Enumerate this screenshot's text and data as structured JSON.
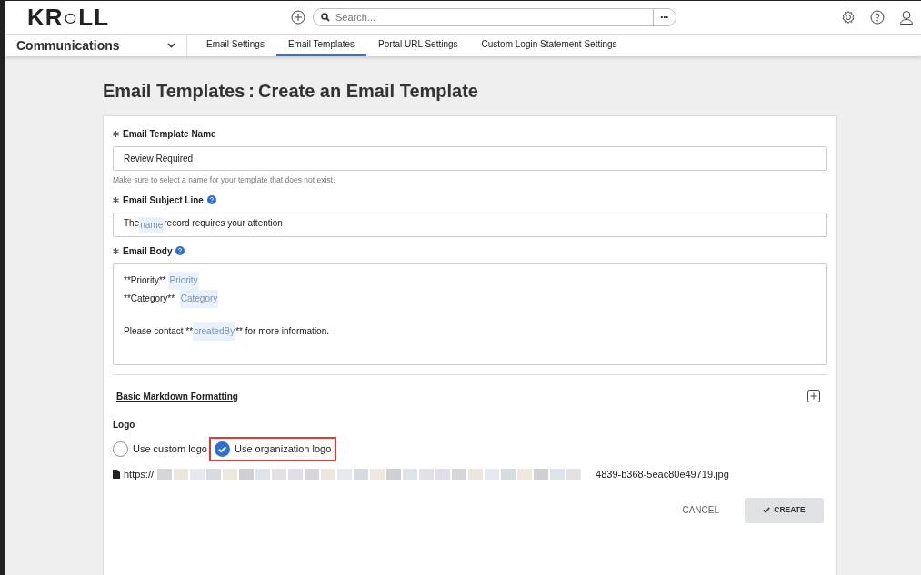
{
  "header": {
    "logo": "KR○LL",
    "search": {
      "placeholder": "Search..."
    },
    "more": "•••"
  },
  "nav": {
    "section": "Communications",
    "tabs": [
      {
        "label": "Email Settings",
        "selected": false
      },
      {
        "label": "Email Templates",
        "selected": true
      },
      {
        "label": "Portal URL Settings",
        "selected": false
      },
      {
        "label": "Custom Login Statement Settings",
        "selected": false
      }
    ]
  },
  "page_title": {
    "section": "Email Templates",
    "separator": ":",
    "action": "Create an Email Template"
  },
  "form": {
    "name": {
      "label": "Email Template Name",
      "required": true,
      "value": "Review Required",
      "hint": "Make sure to select a name for your template that does not exist."
    },
    "subject": {
      "label": "Email Subject Line",
      "required": true,
      "help": true,
      "segments": [
        {
          "kind": "text",
          "text": "The "
        },
        {
          "kind": "token",
          "text": "name"
        },
        {
          "kind": "text",
          "text": " record requires your attention"
        }
      ]
    },
    "body": {
      "label": "Email Body",
      "required": true,
      "help": true,
      "lines": [
        {
          "kind": "text",
          "segments": [
            {
              "kind": "text",
              "text": "**Priority** "
            },
            {
              "kind": "token",
              "text": "Priority"
            }
          ]
        },
        {
          "kind": "text",
          "segments": [
            {
              "kind": "text",
              "text": "**Category**  "
            },
            {
              "kind": "token",
              "text": "Category"
            }
          ]
        },
        {
          "kind": "blank"
        },
        {
          "kind": "text",
          "segments": [
            {
              "kind": "text",
              "text": "Please contact **"
            },
            {
              "kind": "token",
              "text": "createdBy"
            },
            {
              "kind": "text",
              "text": "** for more information."
            }
          ]
        }
      ]
    },
    "markdown_link": "Basic Markdown Formatting",
    "logo": {
      "label": "Logo",
      "options": [
        {
          "label": "Use custom logo",
          "selected": false,
          "highlighted": false
        },
        {
          "label": "Use organization logo",
          "selected": true,
          "highlighted": true
        }
      ],
      "file": {
        "prefix": "https://",
        "suffix": "4839-b368-5eac80e49719.jpg"
      }
    },
    "buttons": [
      {
        "kind": "cancel",
        "label": "CANCEL"
      },
      {
        "kind": "create",
        "label": "CREATE"
      }
    ]
  }
}
